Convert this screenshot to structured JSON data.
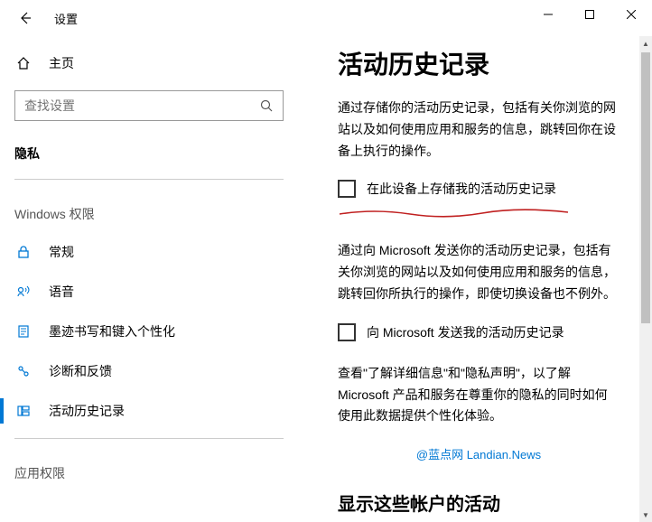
{
  "window": {
    "title": "设置"
  },
  "sidebar": {
    "home_label": "主页",
    "search_placeholder": "查找设置",
    "section_privacy": "隐私",
    "subsection_windows_permissions": "Windows 权限",
    "subsection_app_permissions": "应用权限",
    "items": [
      {
        "label": "常规"
      },
      {
        "label": "语音"
      },
      {
        "label": "墨迹书写和键入个性化"
      },
      {
        "label": "诊断和反馈"
      },
      {
        "label": "活动历史记录"
      }
    ]
  },
  "content": {
    "heading": "活动历史记录",
    "para1": "通过存储你的活动历史记录，包括有关你浏览的网站以及如何使用应用和服务的信息，跳转回你在设备上执行的操作。",
    "checkbox1_label": "在此设备上存储我的活动历史记录",
    "para2": "通过向 Microsoft 发送你的活动历史记录，包括有关你浏览的网站以及如何使用应用和服务的信息，跳转回你所执行的操作，即使切换设备也不例外。",
    "checkbox2_label": "向 Microsoft 发送我的活动历史记录",
    "para3": "查看\"了解详细信息\"和\"隐私声明\"，以了解 Microsoft 产品和服务在尊重你的隐私的同时如何使用此数据提供个性化体验。",
    "watermark": "@蓝点网 Landian.News",
    "subheading": "显示这些帐户的活动"
  },
  "colors": {
    "accent": "#0078d4",
    "underline": "#c02020"
  }
}
